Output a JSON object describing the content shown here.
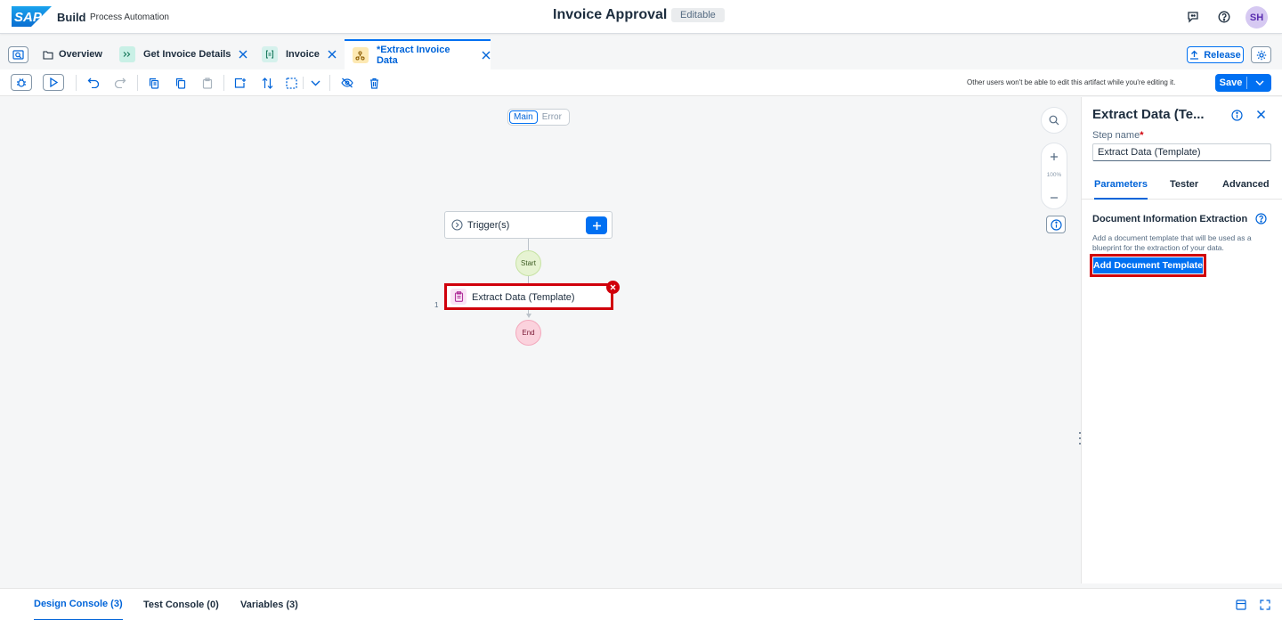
{
  "shell": {
    "logo_text": "SAP",
    "brand": "Build",
    "sub_brand": "Process Automation",
    "title": "Invoice Approval",
    "badge": "Editable",
    "avatar_initials": "SH"
  },
  "tabs": [
    {
      "label": "Overview",
      "icon": "folder-icon"
    },
    {
      "label": "Get Invoice Details",
      "icon": "subprocess-icon",
      "closable": true
    },
    {
      "label": "Invoice",
      "icon": "form-icon",
      "closable": true
    },
    {
      "label": "*Extract Invoice Data",
      "icon": "automation-icon",
      "closable": true,
      "active": true
    }
  ],
  "release_label": "Release",
  "toolbar": {
    "note": "Other users won't be able to edit this artifact while you're editing it.",
    "save_label": "Save"
  },
  "canvas": {
    "segmented": [
      "Main",
      "Error"
    ],
    "zoom_level": "100%",
    "trigger_label": "Trigger(s)",
    "start_label": "Start",
    "end_label": "End",
    "step_label": "Extract Data (Template)",
    "step_number": "1"
  },
  "panel": {
    "title": "Extract Data (Te...",
    "step_name_label": "Step name",
    "step_name_value": "Extract Data (Template)",
    "tabs": [
      "Parameters",
      "Tester",
      "Advanced"
    ],
    "section_title": "Document Information Extraction",
    "section_desc": "Add a document template that will be used as a blueprint for the extraction of your data.",
    "add_button": "Add Document Template"
  },
  "bottom_tabs": [
    "Design Console (3)",
    "Test Console (0)",
    "Variables (3)"
  ],
  "colors": {
    "accent": "#0070f2",
    "error": "#d0000b",
    "start_node": "#e6f3d2",
    "end_node": "#fbd2dd"
  }
}
